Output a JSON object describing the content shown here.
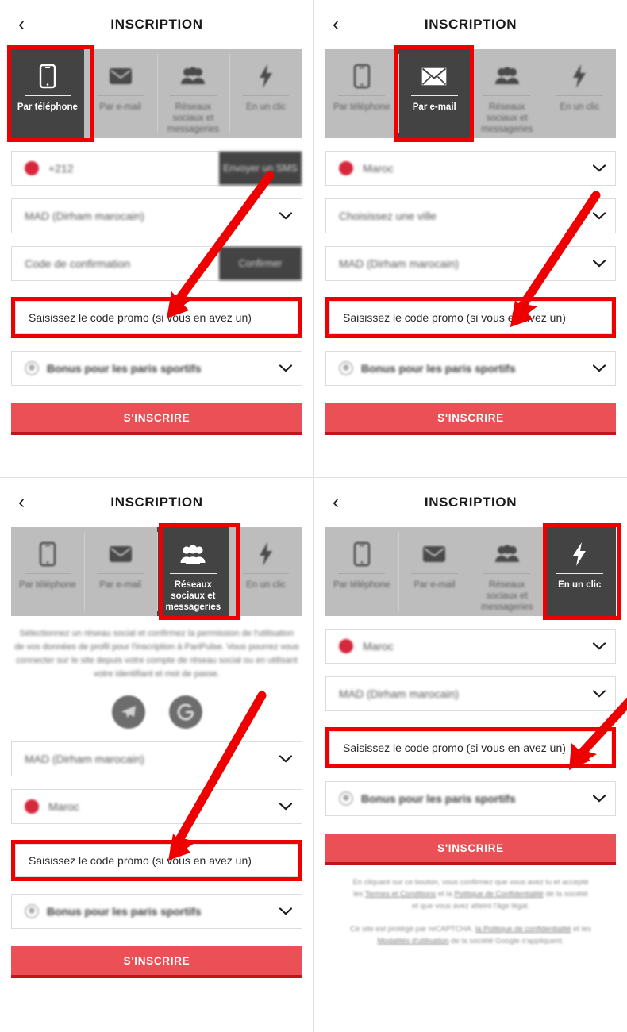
{
  "header": {
    "title": "INSCRIPTION",
    "back_icon": "chevron-left-icon"
  },
  "tabs": [
    {
      "label": "Par téléphone",
      "icon": "mobile-phone-icon"
    },
    {
      "label": "Par e-mail",
      "icon": "envelope-icon"
    },
    {
      "label": "Réseaux sociaux et messageries",
      "icon": "people-group-icon"
    },
    {
      "label": "En un clic",
      "icon": "lightning-bolt-icon"
    }
  ],
  "fields": {
    "phone_prefix": "+212",
    "send_sms": "Envoyer un SMS",
    "currency": "MAD (Dirham marocain)",
    "confirmation_code": "Code de confirmation",
    "confirm_button": "Confirmer",
    "country": "Maroc",
    "city": "Choisissez une ville",
    "promo": "Saisissez le code promo (si vous en avez un)",
    "bonus": "Bonus pour les paris sportifs"
  },
  "submit_label": "S'INSCRIRE",
  "social": {
    "description": "Sélectionnez un réseau social et confirmez la permission de l'utilisation de vos données de profil pour l'inscription à PariPulse. Vous pourrez vous connecter sur le site depuis votre compte de réseau social ou en utilisant votre identifiant et mot de passe.",
    "buttons": [
      {
        "name": "telegram",
        "icon": "telegram-icon"
      },
      {
        "name": "google",
        "icon": "google-g-icon"
      }
    ]
  },
  "legal": {
    "terms_text_1": "En cliquant sur ce bouton, vous confirmez que vous avez lu et accepté",
    "terms_text_2": "les ",
    "terms_link_1": "Termes et Conditions",
    "terms_text_3": " et la ",
    "terms_link_2": "Politique de Confidentialité",
    "terms_text_4": " de la société",
    "terms_text_5": "et que vous avez atteint l'âge légal.",
    "recaptcha_text_1": "Ce site est protégé par reCAPTCHA. ",
    "recaptcha_link_1": "la Politique de confidentialité",
    "recaptcha_text_2": " et les ",
    "recaptcha_link_2": "Modalités d'utilisation",
    "recaptcha_text_3": " de la société Google s'appliquent."
  },
  "colors": {
    "annotation_red": "#EE0000",
    "submit_red": "#EA5055",
    "submit_red_dark": "#C2151B",
    "tab_inactive_gray": "#BDBDBD",
    "tab_active_dark": "#434343"
  }
}
